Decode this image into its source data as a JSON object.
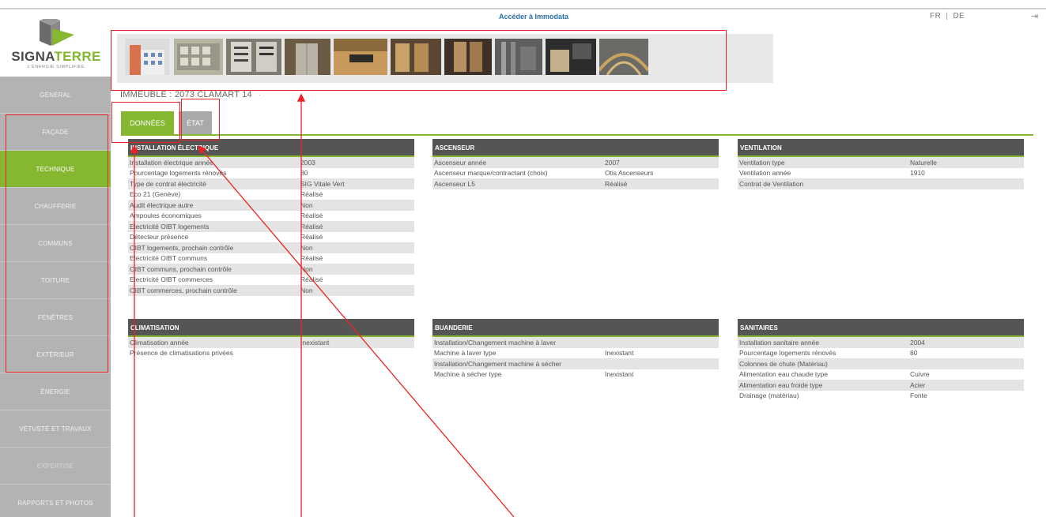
{
  "header": {
    "immodata_link": "Accéder à Immodata",
    "lang_fr": "FR",
    "lang_sep": "|",
    "lang_de": "DE",
    "logout_icon": "⇥"
  },
  "logo": {
    "part1": "SIGNA",
    "part2": "TERRE",
    "tagline": "L'ÉNERGIE SIMPLIFIÉE"
  },
  "sidebar": {
    "items": [
      {
        "label": "GÉNÉRAL"
      },
      {
        "label": "FAÇADE"
      },
      {
        "label": "TECHNIQUE"
      },
      {
        "label": "CHAUFFERIE"
      },
      {
        "label": "COMMUNS"
      },
      {
        "label": "TOITURE"
      },
      {
        "label": "FENÊTRES"
      },
      {
        "label": "EXTÉRIEUR"
      },
      {
        "label": "ÉNERGIE"
      },
      {
        "label": "VÉTUSTÉ ET TRAVAUX"
      },
      {
        "label": "EXPERTISE"
      },
      {
        "label": "RAPPORTS ET PHOTOS"
      }
    ],
    "active": "TECHNIQUE"
  },
  "building": {
    "title": "IMMEUBLE : 2073 CLAMART 14",
    "suffix": "·"
  },
  "tabs": {
    "donnees": "DONNÉES",
    "etat": "ÉTAT"
  },
  "panels": {
    "electrique": {
      "title": "INSTALLATION ÉLECTRIQUE",
      "rows": [
        {
          "label": "Installation électrique année",
          "value": "2003"
        },
        {
          "label": "Pourcentage logements rénovés",
          "value": "80"
        },
        {
          "label": "Type de contrat électricité",
          "value": "SIG Vitale Vert"
        },
        {
          "label": "Eco 21 (Genève)",
          "value": "Réalisé"
        },
        {
          "label": "Audit électrique autre",
          "value": "Non"
        },
        {
          "label": "Ampoules économiques",
          "value": "Réalisé"
        },
        {
          "label": "Electricité OIBT logements",
          "value": "Réalisé"
        },
        {
          "label": "Détecteur présence",
          "value": "Réalisé"
        },
        {
          "label": "OIBT logements, prochain contrôle",
          "value": "Non"
        },
        {
          "label": "Electricité OIBT communs",
          "value": "Réalisé"
        },
        {
          "label": "OIBT communs, prochain contrôle",
          "value": "Non"
        },
        {
          "label": "Electricité OIBT commerces",
          "value": "Réalisé"
        },
        {
          "label": "OIBT commerces, prochain contrôle",
          "value": "Non"
        }
      ]
    },
    "ascenseur": {
      "title": "ASCENSEUR",
      "rows": [
        {
          "label": "Ascenseur année",
          "value": "2007"
        },
        {
          "label": "Ascenseur marque/contractant (choix)",
          "value": "Otis Ascenseurs"
        },
        {
          "label": "Ascenseur L5",
          "value": "Réalisé"
        }
      ]
    },
    "ventilation": {
      "title": "VENTILATION",
      "rows": [
        {
          "label": "Ventilation type",
          "value": "Naturelle"
        },
        {
          "label": "Ventilation année",
          "value": "1910"
        },
        {
          "label": "Contrat de Ventilation",
          "value": ""
        }
      ]
    },
    "climatisation": {
      "title": "CLIMATISATION",
      "rows": [
        {
          "label": "Climatisation année",
          "value": "Inexistant"
        },
        {
          "label": "Présence de climatisations privées",
          "value": ""
        }
      ]
    },
    "buanderie": {
      "title": "BUANDERIE",
      "rows": [
        {
          "label": "Installation/Changement machine à laver",
          "value": ""
        },
        {
          "label": "Machine à laver type",
          "value": "Inexistant"
        },
        {
          "label": "Installation/Changement machine à sécher",
          "value": ""
        },
        {
          "label": "Machine à sécher type",
          "value": "Inexistant"
        }
      ]
    },
    "sanitaires": {
      "title": "SANITAIRES",
      "rows": [
        {
          "label": "Installation sanitaire année",
          "value": "2004"
        },
        {
          "label": "Pourcentage logements rénovés",
          "value": "80"
        },
        {
          "label": "Colonnes de chute (Matériau)",
          "value": ""
        },
        {
          "label": "Alimentation eau chaude type",
          "value": "Cuivre"
        },
        {
          "label": "Alimentation eau froide type",
          "value": "Acier"
        },
        {
          "label": "Drainage (matériau)",
          "value": "Fonte"
        }
      ]
    }
  },
  "photos": [
    {
      "name": "photo-facade"
    },
    {
      "name": "photo-electric-meters"
    },
    {
      "name": "photo-electric-panel"
    },
    {
      "name": "photo-elevator-door"
    },
    {
      "name": "photo-elevator-buttons"
    },
    {
      "name": "photo-elevator-lobby"
    },
    {
      "name": "photo-elevator-cabin"
    },
    {
      "name": "photo-boiler-pipes"
    },
    {
      "name": "photo-laundry"
    },
    {
      "name": "photo-stairwell"
    }
  ],
  "colors": {
    "accent_green": "#86b731",
    "sidebar_gray": "#b3b3b3",
    "panel_header": "#555555",
    "annotation_red": "#e22222"
  }
}
